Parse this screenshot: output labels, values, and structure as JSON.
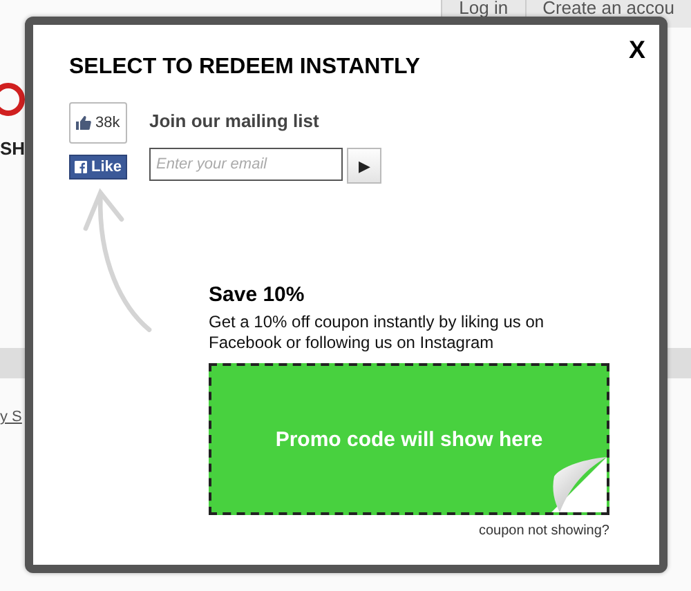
{
  "background_page": {
    "nav_links": [
      "Log in",
      "Create an accou"
    ],
    "logo_text": "SH",
    "link_text": "y S"
  },
  "modal": {
    "close": "X",
    "title": "SELECT TO REDEEM INSTANTLY",
    "like_box": {
      "count": "38k",
      "button": "Like"
    },
    "mailing": {
      "label": "Join our mailing list",
      "placeholder": "Enter your email",
      "submit": "▶"
    },
    "offer": {
      "heading": "Save 10%",
      "text": "Get a 10% off coupon instantly by liking us on Facebook or following us on Instagram",
      "promo": "Promo code will show here",
      "help_link": "coupon not showing?"
    }
  }
}
